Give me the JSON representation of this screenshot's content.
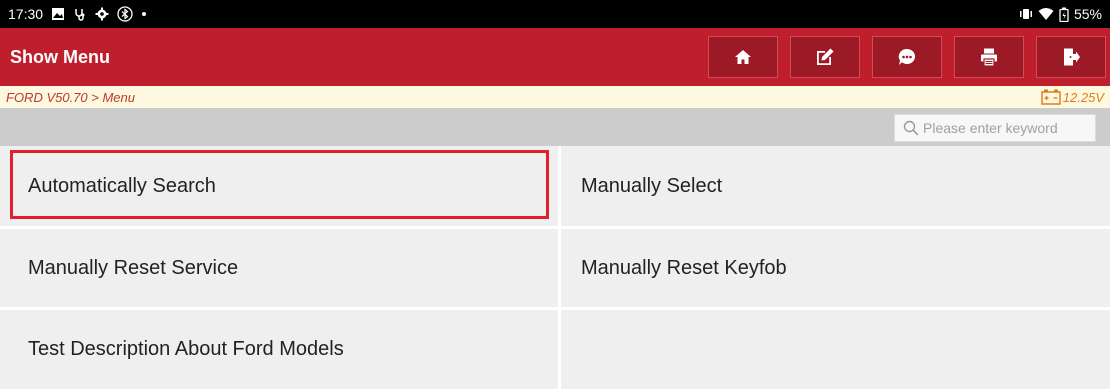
{
  "status_bar": {
    "time": "17:30",
    "battery": "55%",
    "icons": [
      "image-icon",
      "stethoscope-icon",
      "settings-icon",
      "bluetooth-icon",
      "dot-icon",
      "vibrate-icon",
      "wifi-icon",
      "battery-icon"
    ]
  },
  "header": {
    "title": "Show Menu",
    "toolbar": [
      "home-icon",
      "edit-icon",
      "message-icon",
      "print-icon",
      "exit-icon"
    ],
    "accent": "#bf1e2d"
  },
  "breadcrumb": {
    "path": "FORD V50.70 > Menu",
    "voltage": "12.25V"
  },
  "search": {
    "placeholder": "Please enter keyword"
  },
  "menu": {
    "items": [
      {
        "label": "Automatically Search",
        "selected": true
      },
      {
        "label": "Manually Select"
      },
      {
        "label": "Manually Reset Service"
      },
      {
        "label": "Manually Reset Keyfob"
      },
      {
        "label": "Test Description About Ford Models"
      },
      {
        "label": ""
      }
    ]
  }
}
